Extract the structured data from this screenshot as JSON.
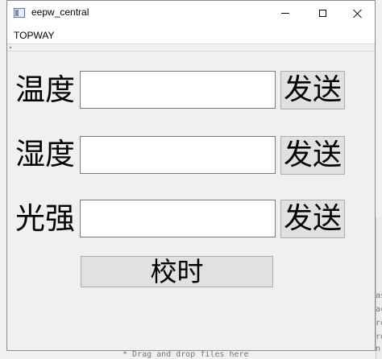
{
  "window": {
    "title": "eepw_central"
  },
  "menubar": {
    "items": [
      "TOPWAY"
    ]
  },
  "rows": [
    {
      "label": "温度",
      "value": "",
      "button": "发送"
    },
    {
      "label": "湿度",
      "value": "",
      "button": "发送"
    },
    {
      "label": "光强",
      "value": "",
      "button": "发送"
    }
  ],
  "sync_button": "校时",
  "background": {
    "hint_text": "* Drag and drop files here",
    "right_fragments": [
      "as",
      "ac",
      "ro",
      "ro",
      "n"
    ]
  }
}
